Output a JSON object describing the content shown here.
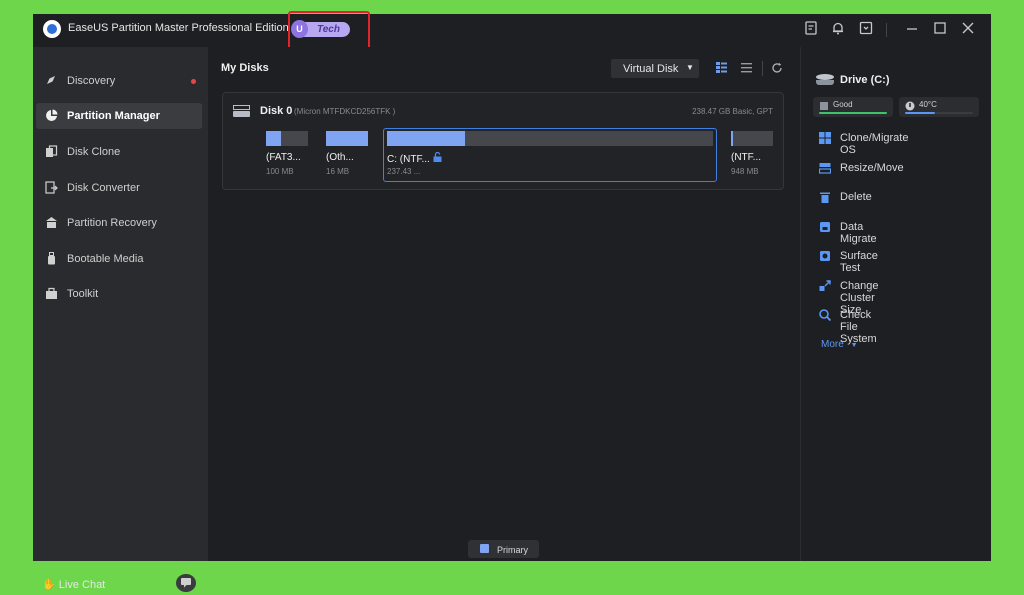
{
  "window": {
    "title": "EaseUS Partition Master Professional Edition",
    "badge_letter": "U",
    "badge_text": "Tech"
  },
  "sidebar": {
    "items": [
      {
        "label": "Discovery",
        "icon": "compass-icon",
        "has_dot": true
      },
      {
        "label": "Partition Manager",
        "icon": "pie-chart-icon",
        "active": true
      },
      {
        "label": "Disk Clone",
        "icon": "clone-icon"
      },
      {
        "label": "Disk Converter",
        "icon": "convert-icon"
      },
      {
        "label": "Partition Recovery",
        "icon": "recovery-icon"
      },
      {
        "label": "Bootable Media",
        "icon": "usb-icon"
      },
      {
        "label": "Toolkit",
        "icon": "toolkit-icon"
      }
    ],
    "live_chat": "Live Chat"
  },
  "main": {
    "title": "My Disks",
    "virtual_disk": "Virtual Disk",
    "disk": {
      "name": "Disk 0",
      "model": "(Micron MTFDKCD256TFK )",
      "info": "238.47 GB Basic, GPT",
      "partitions": [
        {
          "name": "(FAT3...",
          "size": "100 MB",
          "used": 0.35
        },
        {
          "name": "(Oth...",
          "size": "16 MB",
          "used": 1.0
        },
        {
          "name": "C: (NTF...",
          "size": "237.43 ...",
          "used": 0.24,
          "locked": true
        },
        {
          "name": "(NTF...",
          "size": "948 MB",
          "used": 0.05
        }
      ]
    },
    "legend": "Primary"
  },
  "right_panel": {
    "drive_title": "Drive (C:)",
    "health": "Good",
    "temperature": "40°C",
    "actions": [
      {
        "label": "Clone/Migrate OS",
        "icon": "windows-icon"
      },
      {
        "label": "Resize/Move",
        "icon": "resize-icon"
      },
      {
        "label": "Delete",
        "icon": "trash-icon"
      },
      {
        "label": "Data Migrate",
        "icon": "migrate-icon"
      },
      {
        "label": "Surface Test",
        "icon": "surface-test-icon"
      },
      {
        "label": "Change Cluster Size",
        "icon": "cluster-icon"
      },
      {
        "label": "Check File System",
        "icon": "check-fs-icon"
      }
    ],
    "more": "More"
  },
  "colors": {
    "accent": "#5b98f5",
    "partition_fill": "#7ea4f2",
    "background": "#1e1f22",
    "sidebar": "#2a2b2e",
    "highlight_box": "#e0242c",
    "health_bar": "#3cc46a"
  }
}
